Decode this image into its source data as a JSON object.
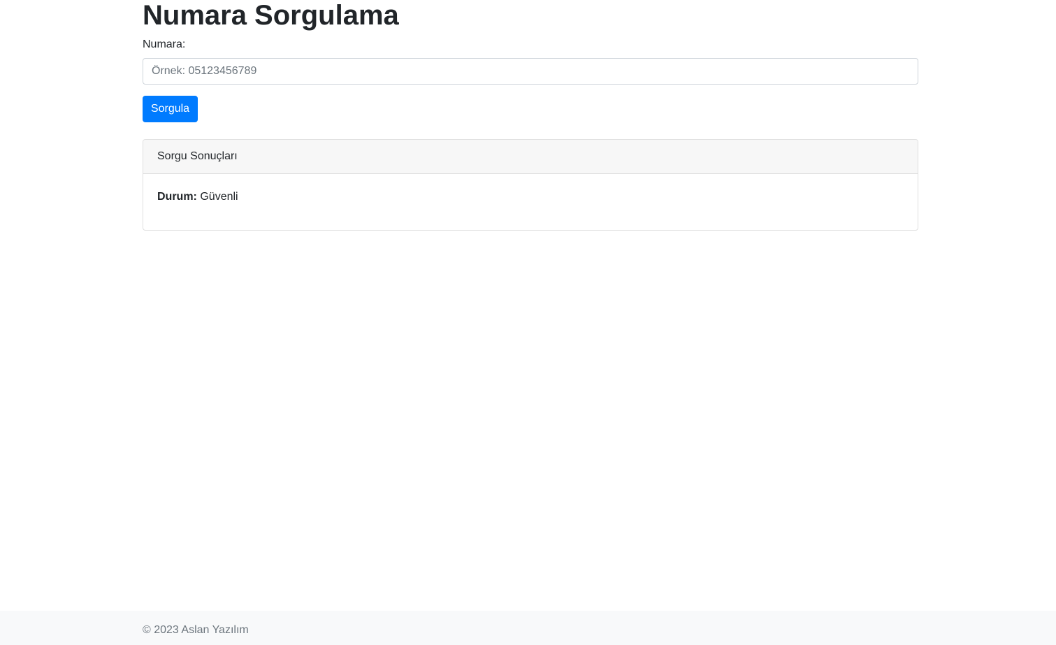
{
  "page": {
    "title": "Numara Sorgulama"
  },
  "form": {
    "number_label": "Numara:",
    "number_value": "",
    "number_placeholder": "Örnek: 05123456789",
    "submit_label": "Sorgula"
  },
  "results": {
    "header": "Sorgu Sonuçları",
    "status_label": "Durum:",
    "status_value": "Güvenli"
  },
  "footer": {
    "text": "© 2023 Aslan Yazılım"
  },
  "colors": {
    "primary": "#007bff",
    "footer_bg": "#f8f9fa",
    "card_header_bg": "#f7f7f7",
    "text": "#212529",
    "muted": "#6c757d"
  }
}
